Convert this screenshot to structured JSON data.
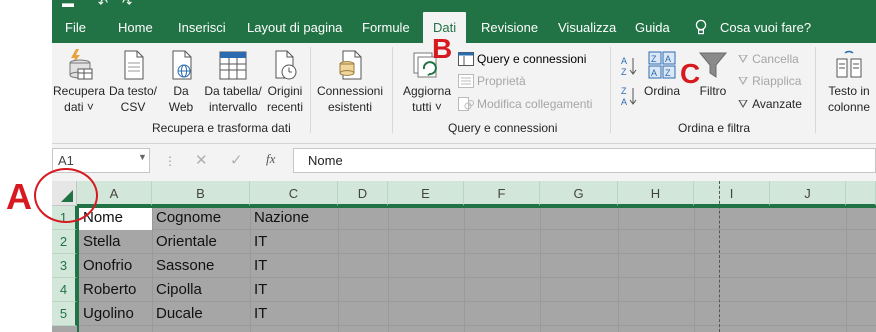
{
  "colors": {
    "excel_green": "#217346",
    "ribbon_bg": "#f3f3f3",
    "selected_grid": "#a6a6a6",
    "header_selected": "#d3e6da",
    "annotation_red": "#d71920"
  },
  "menu": {
    "tabs": [
      {
        "label": "File"
      },
      {
        "label": "Home"
      },
      {
        "label": "Inserisci"
      },
      {
        "label": "Layout di pagina"
      },
      {
        "label": "Formule"
      },
      {
        "label": "Dati",
        "active": true
      },
      {
        "label": "Revisione"
      },
      {
        "label": "Visualizza"
      },
      {
        "label": "Guida"
      }
    ],
    "tell_me": "Cosa vuoi fare?"
  },
  "ribbon": {
    "groups": {
      "get_transform": {
        "label": "Recupera e trasforma dati",
        "buttons": [
          {
            "label1": "Recupera",
            "label2": "dati ˅",
            "icon": "database-icon"
          },
          {
            "label1": "Da testo/",
            "label2": "CSV",
            "icon": "text-file-icon"
          },
          {
            "label1": "Da",
            "label2": "Web",
            "icon": "web-file-icon"
          },
          {
            "label1": "Da tabella/",
            "label2": "intervallo",
            "icon": "table-icon"
          },
          {
            "label1": "Origini",
            "label2": "recenti",
            "icon": "recent-sources-icon"
          },
          {
            "label1": "Connessioni",
            "label2": "esistenti",
            "icon": "connections-icon"
          }
        ]
      },
      "queries": {
        "label": "Query e connessioni",
        "refresh": {
          "label1": "Aggiorna",
          "label2": "tutti ˅"
        },
        "small": [
          {
            "label": "Query e connessioni",
            "enabled": true
          },
          {
            "label": "Proprietà",
            "enabled": false
          },
          {
            "label": "Modifica collegamenti",
            "enabled": false
          }
        ]
      },
      "sort_filter": {
        "label": "Ordina e filtra",
        "sort": "Ordina",
        "filter": "Filtro",
        "small": [
          {
            "label": "Cancella",
            "enabled": false
          },
          {
            "label": "Riapplica",
            "enabled": false
          },
          {
            "label": "Avanzate",
            "enabled": true
          }
        ]
      },
      "data_tools": {
        "text_to_columns_1": "Testo in",
        "text_to_columns_2": "colonne"
      }
    }
  },
  "formula_bar": {
    "name_box": "A1",
    "dots": "⋮",
    "fx": "fx",
    "content": "Nome"
  },
  "sheet": {
    "columns": [
      "A",
      "B",
      "C",
      "D",
      "E",
      "F",
      "G",
      "H",
      "I",
      "J"
    ],
    "rows": [
      "1",
      "2",
      "3",
      "4",
      "5"
    ],
    "cells": [
      [
        "Nome",
        "Cognome",
        "Nazione"
      ],
      [
        "Stella",
        "Orientale",
        "IT"
      ],
      [
        "Onofrio",
        "Sassone",
        "IT"
      ],
      [
        "Roberto",
        "Cipolla",
        "IT"
      ],
      [
        "Ugolino",
        "Ducale",
        "IT"
      ]
    ]
  },
  "annotations": {
    "a": "A",
    "b": "B",
    "c": "C"
  }
}
